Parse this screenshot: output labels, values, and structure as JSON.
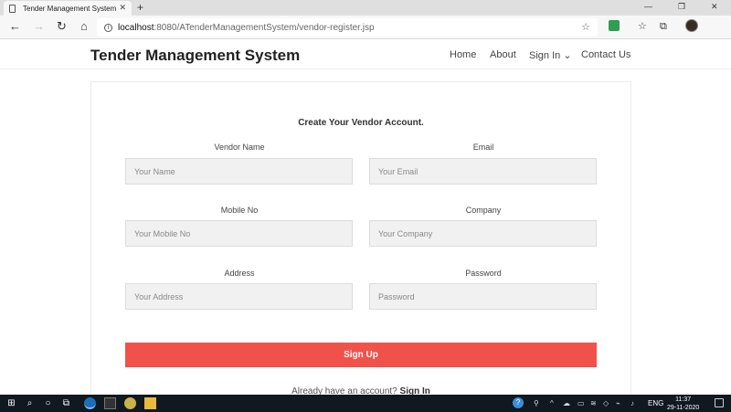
{
  "browser": {
    "tab_title": "Tender Management System",
    "tab_close": "✕",
    "new_tab": "+",
    "url_host": "localhost",
    "url_path": ":8080/ATenderManagementSystem/vendor-register.jsp",
    "controls": {
      "minimize": "—",
      "restore": "❐",
      "close": "✕"
    }
  },
  "site": {
    "brand": "Tender Management System",
    "menu": {
      "home": "Home",
      "about": "About",
      "sign_in": "Sign In",
      "sign_in_chevron": "⌄",
      "contact": "Contact Us"
    }
  },
  "form": {
    "title": "Create Your Vendor Account.",
    "fields": {
      "vendor_name": {
        "label": "Vendor Name",
        "placeholder": "Your Name"
      },
      "email": {
        "label": "Email",
        "placeholder": "Your Email"
      },
      "mobile": {
        "label": "Mobile No",
        "placeholder": "Your Mobile No"
      },
      "company": {
        "label": "Company",
        "placeholder": "Your Company"
      },
      "address": {
        "label": "Address",
        "placeholder": "Your Address"
      },
      "password": {
        "label": "Password",
        "placeholder": "Password"
      }
    },
    "submit": "Sign Up",
    "footer_text": "Already have an account?",
    "footer_link": "Sign In"
  },
  "taskbar": {
    "lang": "ENG",
    "time": "11:37",
    "date": "29-11-2020"
  },
  "colors": {
    "accent": "#f0524a",
    "taskbar": "#101820"
  }
}
